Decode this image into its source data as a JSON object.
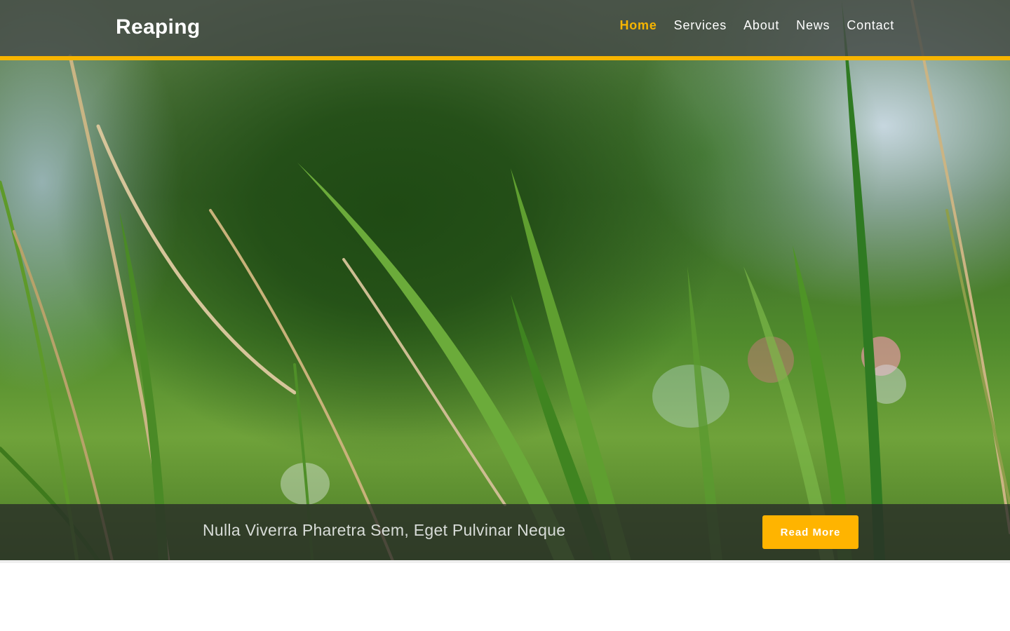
{
  "brand": {
    "name": "Reaping"
  },
  "nav": {
    "items": [
      {
        "label": "Home",
        "active": true
      },
      {
        "label": "Services",
        "active": false
      },
      {
        "label": "About",
        "active": false
      },
      {
        "label": "News",
        "active": false
      },
      {
        "label": "Contact",
        "active": false
      }
    ]
  },
  "hero": {
    "caption": "Nulla Viverra Pharetra Sem, Eget Pulvinar Neque",
    "button_label": "Read More"
  },
  "colors": {
    "accent": "#f7b500",
    "button": "#ffb400",
    "navbar": "#464a48",
    "caption_bar": "#282a28"
  }
}
